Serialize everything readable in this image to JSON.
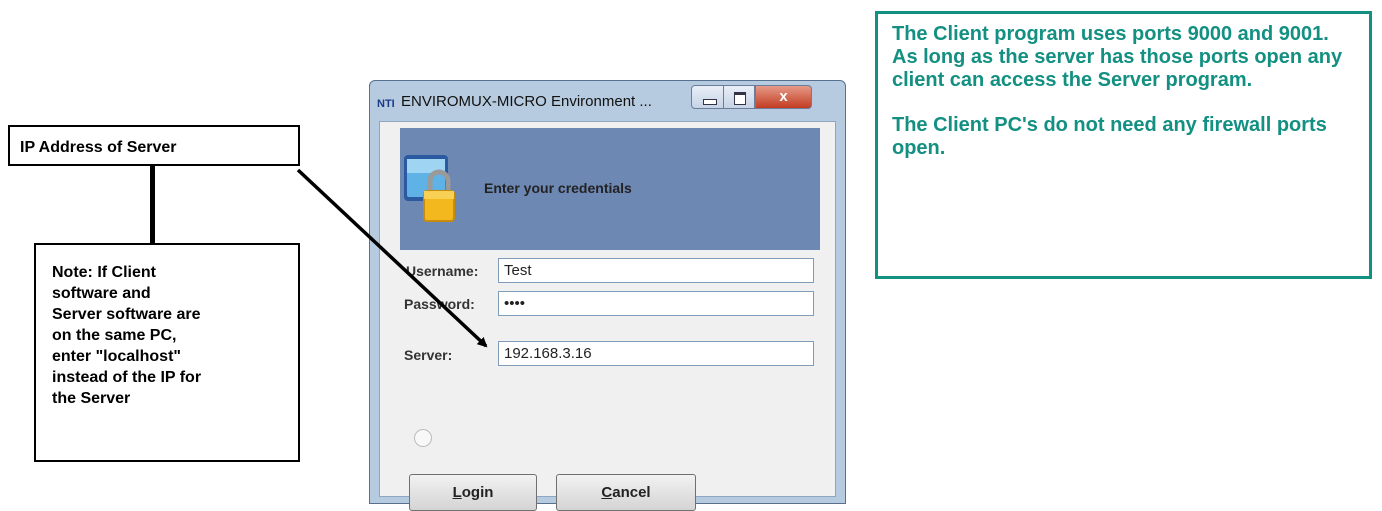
{
  "callouts": {
    "ip_address": "IP Address of Server",
    "note": "Note: If Client\nsoftware and\nServer software are\non the same PC,\nenter \"localhost\"\ninstead of the IP for\nthe Server"
  },
  "info_box": {
    "paragraph1": "The Client program uses ports 9000 and 9001.  As long as the server has those ports open any client can access the Server program.",
    "paragraph2": "The Client PC's do not need any firewall ports open.",
    "color": "#139082"
  },
  "window": {
    "logo": "NTI",
    "title": "ENVIROMUX-MICRO Environment ...",
    "close_glyph": "x",
    "header": "Enter your credentials",
    "username_label": "Username:",
    "username_value": "Test",
    "password_label": "Password:",
    "password_value": "••••",
    "server_label": "Server:",
    "server_value": "192.168.3.16",
    "login_label": "Login",
    "cancel_label": "Cancel",
    "lock_icon": "computer-lock-icon"
  }
}
